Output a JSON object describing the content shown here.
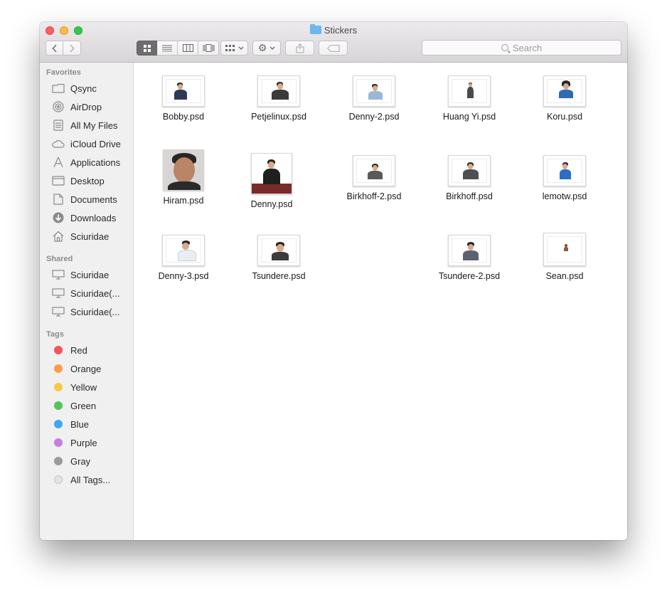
{
  "window": {
    "title": "Stickers"
  },
  "toolbar": {
    "search_placeholder": "Search",
    "back_icon": "chevron-left-icon",
    "forward_icon": "chevron-right-icon",
    "views": [
      "icon-view",
      "list-view",
      "column-view",
      "cover-flow-view"
    ],
    "active_view": "icon-view"
  },
  "sidebar": {
    "favorites_title": "Favorites",
    "favorites": [
      {
        "label": "Qsync",
        "icon": "folder-icon"
      },
      {
        "label": "AirDrop",
        "icon": "airdrop-icon"
      },
      {
        "label": "All My Files",
        "icon": "all-files-icon"
      },
      {
        "label": "iCloud Drive",
        "icon": "cloud-icon"
      },
      {
        "label": "Applications",
        "icon": "applications-icon"
      },
      {
        "label": "Desktop",
        "icon": "desktop-icon"
      },
      {
        "label": "Documents",
        "icon": "document-icon"
      },
      {
        "label": "Downloads",
        "icon": "download-icon"
      },
      {
        "label": "Sciuridae",
        "icon": "home-icon"
      }
    ],
    "shared_title": "Shared",
    "shared": [
      {
        "label": "Sciuridae",
        "icon": "computer-icon"
      },
      {
        "label": "Sciuridae(...",
        "icon": "computer-icon"
      },
      {
        "label": "Sciuridae(...",
        "icon": "computer-icon"
      }
    ],
    "tags_title": "Tags",
    "tags": [
      {
        "label": "Red",
        "color": "#f4535a"
      },
      {
        "label": "Orange",
        "color": "#f99c4c"
      },
      {
        "label": "Yellow",
        "color": "#f6c94a"
      },
      {
        "label": "Green",
        "color": "#4fc756"
      },
      {
        "label": "Blue",
        "color": "#3da9f0"
      },
      {
        "label": "Purple",
        "color": "#c77ee0"
      },
      {
        "label": "Gray",
        "color": "#9a9a9a"
      },
      {
        "label": "All Tags...",
        "color": "#dcdcdc"
      }
    ]
  },
  "files": [
    {
      "name": "Bobby.psd"
    },
    {
      "name": "Petjelinux.psd"
    },
    {
      "name": "Denny-2.psd"
    },
    {
      "name": "Huang Yi.psd"
    },
    {
      "name": "Koru.psd"
    },
    {
      "name": "Hiram.psd"
    },
    {
      "name": "Denny.psd"
    },
    {
      "name": "Birkhoff-2.psd"
    },
    {
      "name": "Birkhoff.psd"
    },
    {
      "name": "lemotw.psd"
    },
    {
      "name": "Denny-3.psd"
    },
    {
      "name": "Tsundere.psd"
    },
    {
      "name": "Tsundere-2.psd"
    },
    {
      "name": "Sean.psd"
    }
  ]
}
